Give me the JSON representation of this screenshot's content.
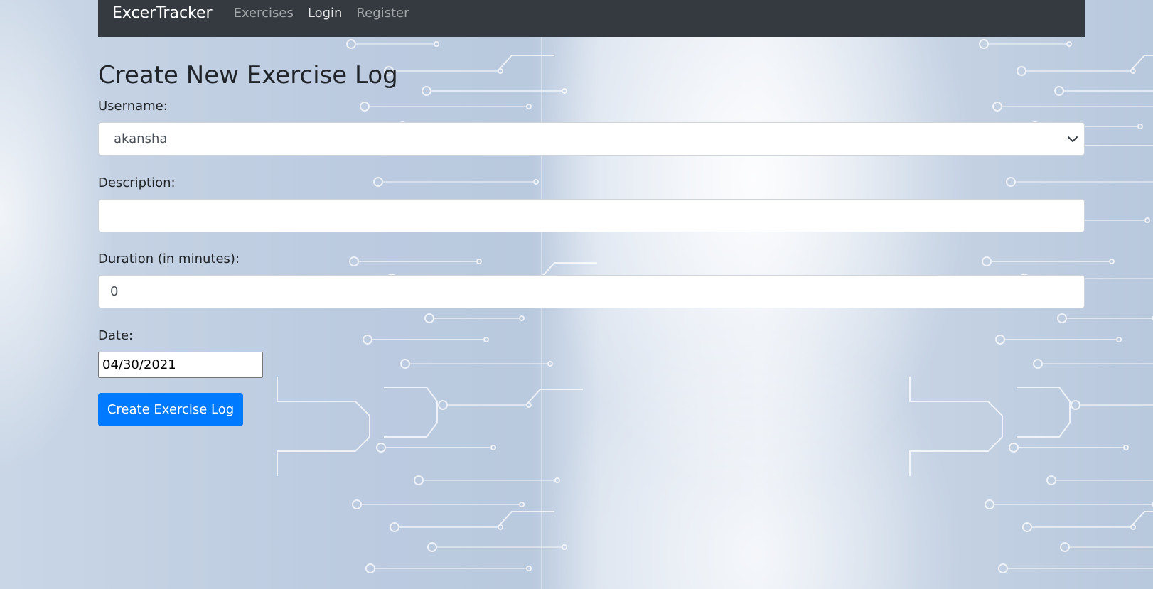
{
  "navbar": {
    "brand": "ExcerTracker",
    "links": [
      {
        "label": "Exercises",
        "active": false
      },
      {
        "label": "Login",
        "active": true
      },
      {
        "label": "Register",
        "active": false
      }
    ],
    "background_color": "#343a40"
  },
  "page": {
    "title": "Create New Exercise Log"
  },
  "form": {
    "username": {
      "label": "Username:",
      "value": "akansha"
    },
    "description": {
      "label": "Description:",
      "value": ""
    },
    "duration": {
      "label": "Duration (in minutes):",
      "value": "0"
    },
    "date": {
      "label": "Date:",
      "value": "04/30/2021"
    },
    "submit_label": "Create Exercise Log"
  },
  "colors": {
    "primary": "#007bff",
    "text": "#212529"
  },
  "icons": {
    "select_arrow": "chevron-down-icon"
  }
}
